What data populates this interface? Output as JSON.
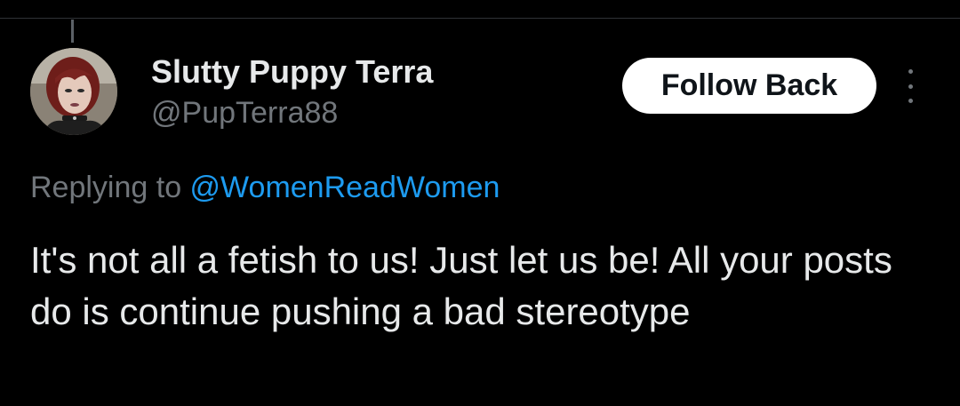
{
  "author": {
    "display_name": "Slutty Puppy Terra",
    "handle": "@PupTerra88"
  },
  "actions": {
    "follow_label": "Follow Back",
    "more_icon": "more-vertical-icon"
  },
  "reply": {
    "prefix": "Replying to ",
    "mention": "@WomenReadWomen"
  },
  "tweet": {
    "text": "It's not all a fetish to us! Just let us be! All your posts do is continue pushing a bad stereotype"
  },
  "colors": {
    "background": "#000000",
    "text": "#e7e9ea",
    "secondary": "#71767b",
    "link": "#1d9bf0",
    "button_bg": "#ffffff"
  }
}
